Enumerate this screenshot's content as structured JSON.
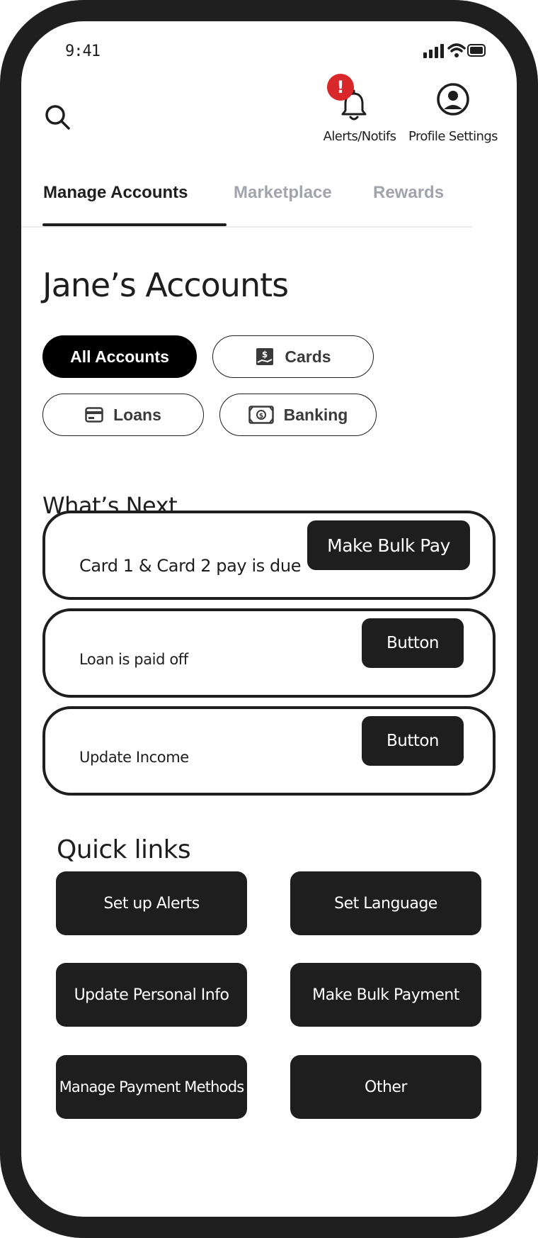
{
  "status_bar": {
    "time": "9:41"
  },
  "header": {
    "alerts_badge": "!",
    "alerts_label": "Alerts/Notifs",
    "profile_label": "Profile Settings"
  },
  "tabs": [
    {
      "label": "Manage Accounts",
      "active": true
    },
    {
      "label": "Marketplace",
      "active": false
    },
    {
      "label": "Rewards",
      "active": false
    }
  ],
  "page_title": "Jane’s Accounts",
  "filters": [
    {
      "label": "All Accounts",
      "active": true,
      "icon": ""
    },
    {
      "label": "Cards",
      "active": false,
      "icon": "cash-hand-icon"
    },
    {
      "label": "Loans",
      "active": false,
      "icon": "credit-card-icon"
    },
    {
      "label": "Banking",
      "active": false,
      "icon": "banknote-icon"
    }
  ],
  "whats_next": {
    "title": "What’s Next",
    "items": [
      {
        "text": "Card 1 & Card 2 pay is due",
        "button": "Make Bulk Pay"
      },
      {
        "text": "Loan is paid off",
        "button": "Button"
      },
      {
        "text": "Update Income",
        "button": "Button"
      }
    ]
  },
  "quick_links": {
    "title": "Quick links",
    "items": [
      "Set up Alerts",
      "Set Language",
      "Update Personal Info",
      "Make Bulk Payment",
      "Manage Payment Methods",
      "Other"
    ]
  },
  "colors": {
    "frame": "#1f1f1f",
    "primary": "#1e1e1e",
    "alert": "#d8282a",
    "inactive_tab": "#a3a3ae"
  }
}
